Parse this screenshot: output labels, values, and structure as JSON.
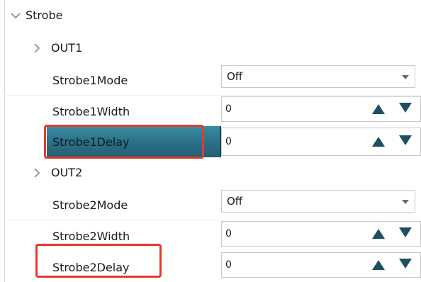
{
  "tree": {
    "root": {
      "label": "Strobe"
    },
    "groups": [
      {
        "label": "OUT1",
        "properties": [
          {
            "label": "Strobe1Mode",
            "kind": "combo",
            "value": "Off"
          },
          {
            "label": "Strobe1Width",
            "kind": "spin",
            "value": "0"
          },
          {
            "label": "Strobe1Delay",
            "kind": "spin",
            "value": "0",
            "selected": true,
            "highlighted": true
          }
        ]
      },
      {
        "label": "OUT2",
        "properties": [
          {
            "label": "Strobe2Mode",
            "kind": "combo",
            "value": "Off"
          },
          {
            "label": "Strobe2Width",
            "kind": "spin",
            "value": "0"
          },
          {
            "label": "Strobe2Delay",
            "kind": "spin",
            "value": "0",
            "highlighted": true
          }
        ]
      }
    ]
  },
  "colors": {
    "selection": "#2b6f86",
    "spin_arrow": "#1d4f63",
    "highlight_border": "#e33a2e"
  },
  "icons": {
    "root_expander": "chevron-down-icon",
    "group_expander": "chevron-right-icon",
    "combo_arrow": "dropdown-arrow-icon",
    "spin_up": "triangle-up-icon",
    "spin_down": "triangle-down-icon"
  }
}
